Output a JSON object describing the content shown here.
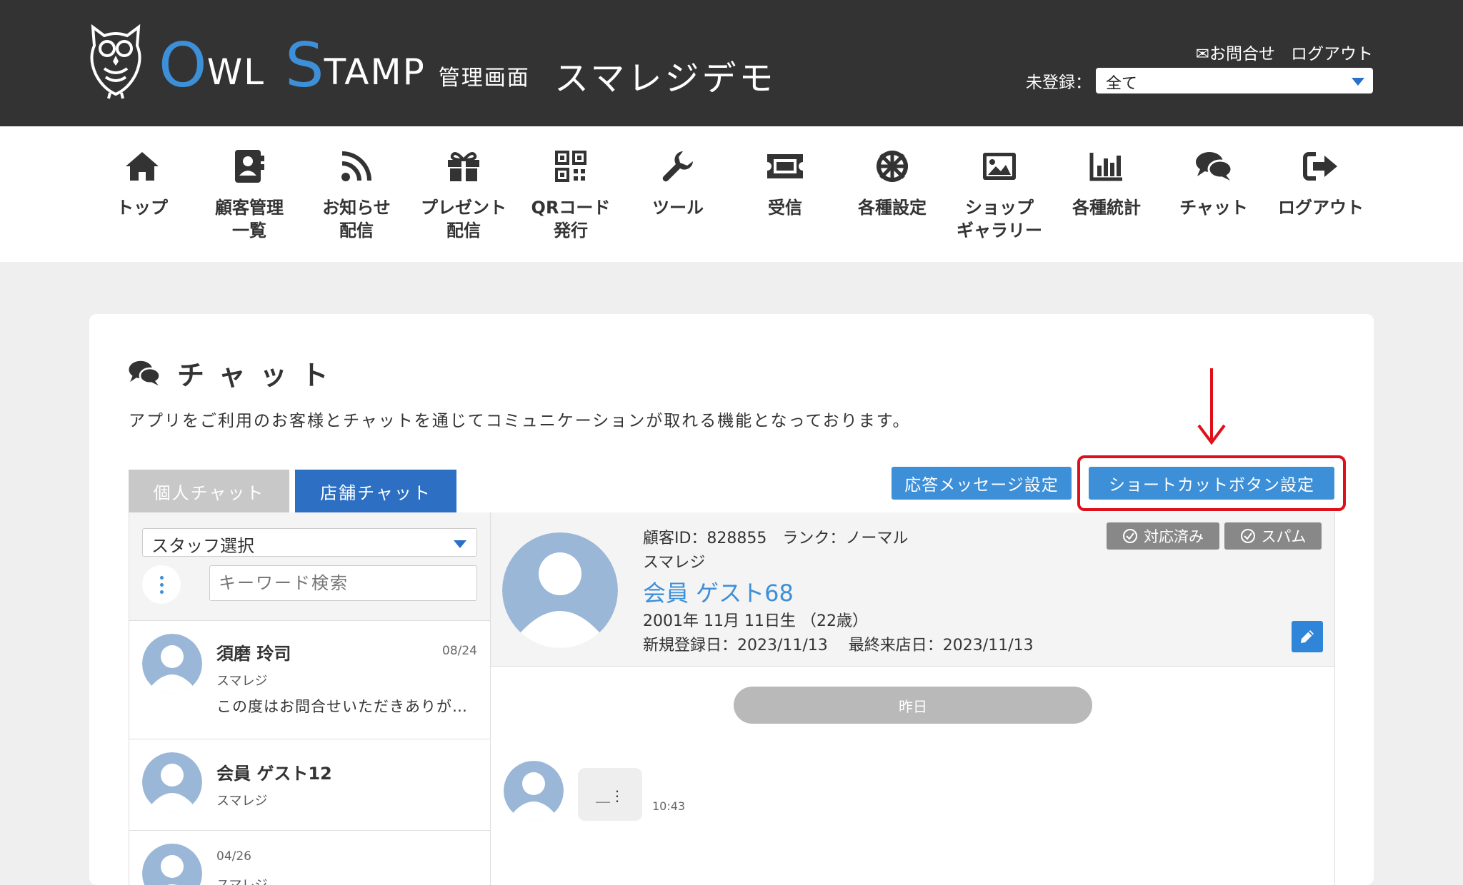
{
  "header": {
    "brand_big_o": "O",
    "brand_small_wl": "WL",
    "brand_big_s": "S",
    "brand_small_tamp": "TAMP",
    "brand_sub": "管理画面",
    "shop_name": "スマレジデモ",
    "contact_label": "✉お問合せ",
    "logout_label": "ログアウト",
    "unregistered_label": "未登録：",
    "unregistered_value": "全て"
  },
  "nav": {
    "items": [
      {
        "label": "トップ",
        "icon": "home-icon"
      },
      {
        "label": "顧客管理\n一覧",
        "icon": "contacts-icon"
      },
      {
        "label": "お知らせ\n配信",
        "icon": "rss-icon"
      },
      {
        "label": "プレゼント\n配信",
        "icon": "gift-icon"
      },
      {
        "label": "QRコード\n発行",
        "icon": "qrcode-icon"
      },
      {
        "label": "ツール",
        "icon": "wrench-icon"
      },
      {
        "label": "受信",
        "icon": "ticket-icon"
      },
      {
        "label": "各種設定",
        "icon": "wheel-icon"
      },
      {
        "label": "ショップ\nギャラリー",
        "icon": "image-icon"
      },
      {
        "label": "各種統計",
        "icon": "bar-chart-icon"
      },
      {
        "label": "チャット",
        "icon": "chat-icon"
      },
      {
        "label": "ログアウト",
        "icon": "sign-out-icon"
      }
    ]
  },
  "page": {
    "title": "チャット",
    "description": "アプリをご利用のお客様とチャットを通じてコミュニケーションが取れる機能となっております。"
  },
  "tabs": {
    "personal": "個人チャット",
    "store": "店舗チャット"
  },
  "buttons": {
    "reply_settings": "応答メッセージ設定",
    "shortcut_settings": "ショートカットボタン設定"
  },
  "left_panel": {
    "staff_select": "スタッフ選択",
    "keyword_placeholder": "キーワード検索",
    "conversations": [
      {
        "name": "須磨 玲司",
        "shop": "スマレジ",
        "date": "08/24",
        "message": "この度はお問合せいただきありがとうございます。"
      },
      {
        "name": "会員 ゲスト12",
        "shop": "スマレジ",
        "date": "",
        "message": ""
      },
      {
        "name": "",
        "shop": "スマレジ",
        "date": "04/26",
        "message": ""
      }
    ]
  },
  "customer": {
    "id_rank": "顧客ID：828855　ランク：ノーマル",
    "shop": "スマレジ",
    "name": "会員 ゲスト68",
    "birthday": "2001年 11月 11日生 （22歳）",
    "dates": "新規登録日：2023/11/13　 最終来店日：2023/11/13",
    "handled_label": "対応済み",
    "spam_label": "スパム"
  },
  "chat": {
    "date_divider": "昨日",
    "bubble_text": "＿⋮",
    "time": "10:43"
  },
  "colors": {
    "header_bg": "#333333",
    "accent_blue": "#3d8fd8",
    "tab_active": "#2c6fc3",
    "highlight_red": "#e0101a"
  }
}
